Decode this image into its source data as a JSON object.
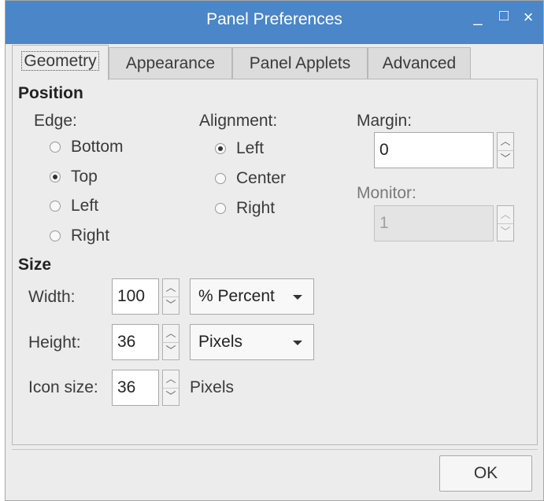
{
  "window": {
    "title": "Panel Preferences",
    "controls": {
      "minimize": "_",
      "maximize": "□",
      "close": "×"
    }
  },
  "tabs": [
    {
      "label": "Geometry",
      "active": true
    },
    {
      "label": "Appearance",
      "active": false
    },
    {
      "label": "Panel Applets",
      "active": false
    },
    {
      "label": "Advanced",
      "active": false
    }
  ],
  "position": {
    "heading": "Position",
    "edge": {
      "label": "Edge:",
      "options": [
        {
          "label": "Bottom",
          "selected": false
        },
        {
          "label": "Top",
          "selected": true
        },
        {
          "label": "Left",
          "selected": false
        },
        {
          "label": "Right",
          "selected": false
        }
      ]
    },
    "alignment": {
      "label": "Alignment:",
      "options": [
        {
          "label": "Left",
          "selected": true
        },
        {
          "label": "Center",
          "selected": false
        },
        {
          "label": "Right",
          "selected": false
        }
      ]
    },
    "margin": {
      "label": "Margin:",
      "value": "0"
    },
    "monitor": {
      "label": "Monitor:",
      "value": "1",
      "disabled": true
    }
  },
  "size": {
    "heading": "Size",
    "width": {
      "label": "Width:",
      "value": "100",
      "unit": "% Percent"
    },
    "height": {
      "label": "Height:",
      "value": "36",
      "unit": "Pixels"
    },
    "icon_size": {
      "label": "Icon size:",
      "value": "36",
      "unit": "Pixels"
    }
  },
  "footer": {
    "ok_label": "OK"
  },
  "colors": {
    "titlebar": "#4a86c8",
    "window_bg": "#ececec"
  }
}
